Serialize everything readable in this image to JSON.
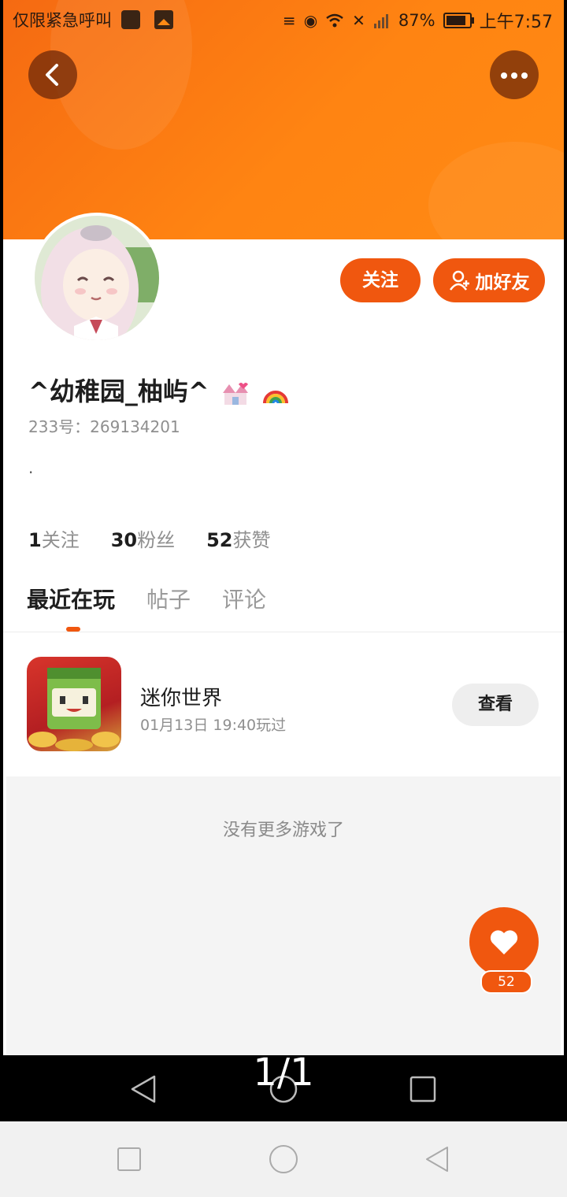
{
  "status_bar": {
    "carrier": "仅限紧急呼叫",
    "battery": "87%",
    "time": "上午7:57"
  },
  "profile": {
    "username": "^幼稚园_柚屿^",
    "uid": "233号：269134201",
    "bio": ".",
    "follow_label": "关注",
    "add_friend_label": "加好友",
    "stats": [
      {
        "num": "1",
        "label": "关注"
      },
      {
        "num": "30",
        "label": "粉丝"
      },
      {
        "num": "52",
        "label": "获赞"
      }
    ]
  },
  "tabs": [
    "最近在玩",
    "帖子",
    "评论"
  ],
  "recent_game": {
    "name": "迷你世界",
    "played": "01月13日 19:40玩过",
    "view_label": "查看"
  },
  "empty_text": "没有更多游戏了",
  "likes": "52",
  "page_counter": "1/1",
  "colors": {
    "accent": "#f0570f",
    "header_gradient_start": "#f56a12",
    "header_gradient_end": "#ff8a14"
  }
}
